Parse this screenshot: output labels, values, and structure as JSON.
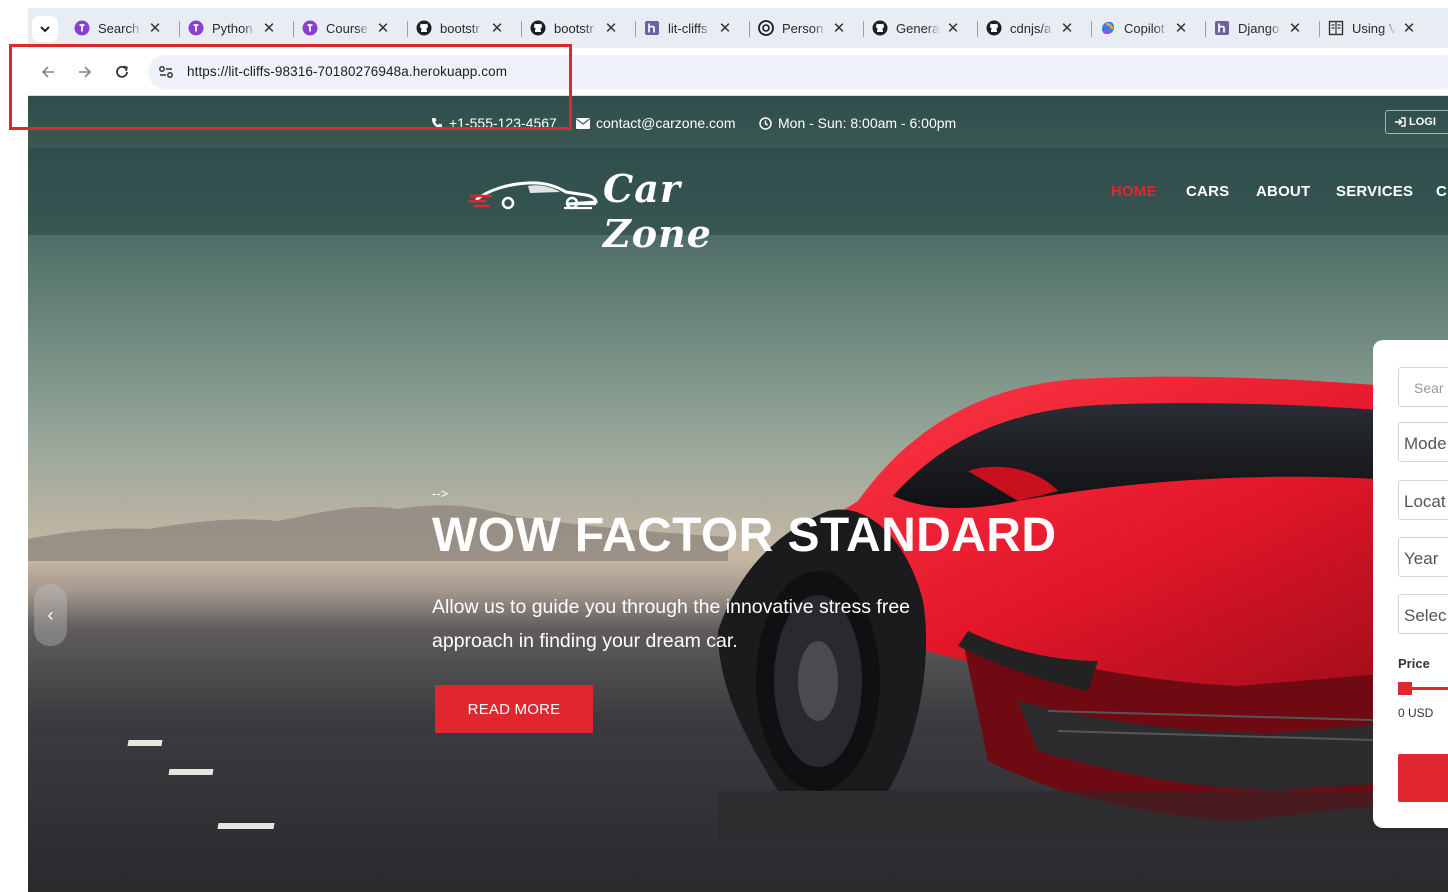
{
  "browser": {
    "tabs": [
      {
        "title": "Search",
        "icon": "custom-purple-icon"
      },
      {
        "title": "Python",
        "icon": "custom-purple-icon"
      },
      {
        "title": "Course",
        "icon": "custom-purple-icon"
      },
      {
        "title": "bootstr",
        "icon": "github-icon"
      },
      {
        "title": "bootstr",
        "icon": "github-icon"
      },
      {
        "title": "lit-cliffs",
        "icon": "heroku-icon"
      },
      {
        "title": "Person",
        "icon": "openai-icon"
      },
      {
        "title": "General",
        "icon": "github-icon"
      },
      {
        "title": "cdnjs/a",
        "icon": "github-icon"
      },
      {
        "title": "Copilot",
        "icon": "copilot-icon"
      },
      {
        "title": "Django",
        "icon": "heroku-icon"
      },
      {
        "title": "Using V",
        "icon": "document-icon"
      }
    ],
    "close_glyph": "✕",
    "url": "https://lit-cliffs-98316-70180276948a.herokuapp.com",
    "annotation_color": "#e0262e"
  },
  "topbar": {
    "phone": "+1-555-123-4567",
    "email": "contact@carzone.com",
    "hours": "Mon - Sun: 8:00am - 6:00pm",
    "login": "LOGI"
  },
  "header": {
    "logo_text": "Car Zone",
    "nav": [
      {
        "label": "HOME",
        "active": true
      },
      {
        "label": "CARS",
        "active": false
      },
      {
        "label": "ABOUT",
        "active": false
      },
      {
        "label": "SERVICES",
        "active": false
      },
      {
        "label": "C",
        "active": false
      }
    ]
  },
  "hero": {
    "note": "-->",
    "title": "WOW FACTOR STANDARD",
    "description": "Allow us to guide you through the innovative stress free approach in finding your dream car.",
    "button": "READ MORE",
    "prev_arrow": "‹"
  },
  "search_panel": {
    "search_placeholder": "Sear",
    "model": "Mode",
    "location": "Locat",
    "year": "Year",
    "select": "Selec",
    "price_label": "Price",
    "price_min": "0 USD"
  },
  "colors": {
    "accent": "#e0262e",
    "chrome_bg": "#e8ecf3",
    "omnibox_bg": "#eef1f8"
  }
}
